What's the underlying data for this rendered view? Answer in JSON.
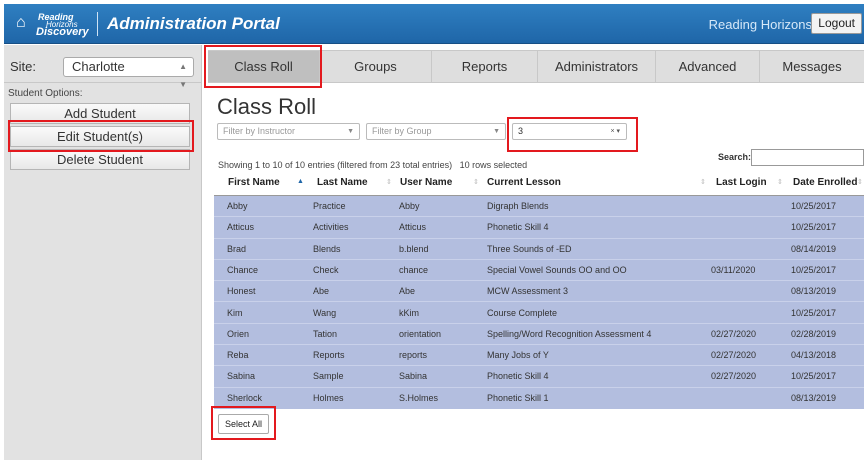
{
  "header": {
    "logo_line1": "Reading",
    "logo_line2": "Horizons",
    "logo_line3": "Discovery",
    "logo_icon": "house-icon",
    "title": "Administration Portal",
    "user": "Reading Horizons",
    "logout_label": "Logout"
  },
  "sidebar": {
    "site_label": "Site:",
    "site_value": "Charlotte",
    "options_label": "Student Options:",
    "buttons": [
      "Add Student",
      "Edit Student(s)",
      "Delete Student"
    ]
  },
  "tabs": [
    "Class Roll",
    "Groups",
    "Reports",
    "Administrators",
    "Advanced",
    "Messages"
  ],
  "main": {
    "title": "Class Roll",
    "filter_instructor_placeholder": "Filter by Instructor",
    "filter_group_placeholder": "Filter by Group",
    "filter_level_value": "3",
    "showing_text": "Showing 1 to 10 of 10 entries (filtered from 23 total entries)",
    "selected_text": "10 rows selected",
    "search_label": "Search:",
    "select_all_label": "Select All"
  },
  "table": {
    "columns": [
      "First Name",
      "Last Name",
      "User Name",
      "Current Lesson",
      "Last Login",
      "Date Enrolled"
    ],
    "rows": [
      [
        "Abby",
        "Practice",
        "Abby",
        "Digraph Blends",
        "",
        "10/25/2017"
      ],
      [
        "Atticus",
        "Activities",
        "Atticus",
        "Phonetic Skill 4",
        "",
        "10/25/2017"
      ],
      [
        "Brad",
        "Blends",
        "b.blend",
        "Three Sounds of -ED",
        "",
        "08/14/2019"
      ],
      [
        "Chance",
        "Check",
        "chance",
        "Special Vowel Sounds OO and OO",
        "03/11/2020",
        "10/25/2017"
      ],
      [
        "Honest",
        "Abe",
        "Abe",
        "MCW Assessment 3",
        "",
        "08/13/2019"
      ],
      [
        "Kim",
        "Wang",
        "kKim",
        "Course Complete",
        "",
        "10/25/2017"
      ],
      [
        "Orien",
        "Tation",
        "orientation",
        "Spelling/Word Recognition Assessment 4",
        "02/27/2020",
        "02/28/2019"
      ],
      [
        "Reba",
        "Reports",
        "reports",
        "Many Jobs of Y",
        "02/27/2020",
        "04/13/2018"
      ],
      [
        "Sabina",
        "Sample",
        "Sabina",
        "Phonetic Skill 4",
        "02/27/2020",
        "10/25/2017"
      ],
      [
        "Sherlock",
        "Holmes",
        "S.Holmes",
        "Phonetic Skill 1",
        "",
        "08/13/2019"
      ]
    ]
  },
  "colors": {
    "header_blue": "#1f66a8",
    "selected_row": "#b3bedf",
    "highlight_red": "#e3191e"
  }
}
